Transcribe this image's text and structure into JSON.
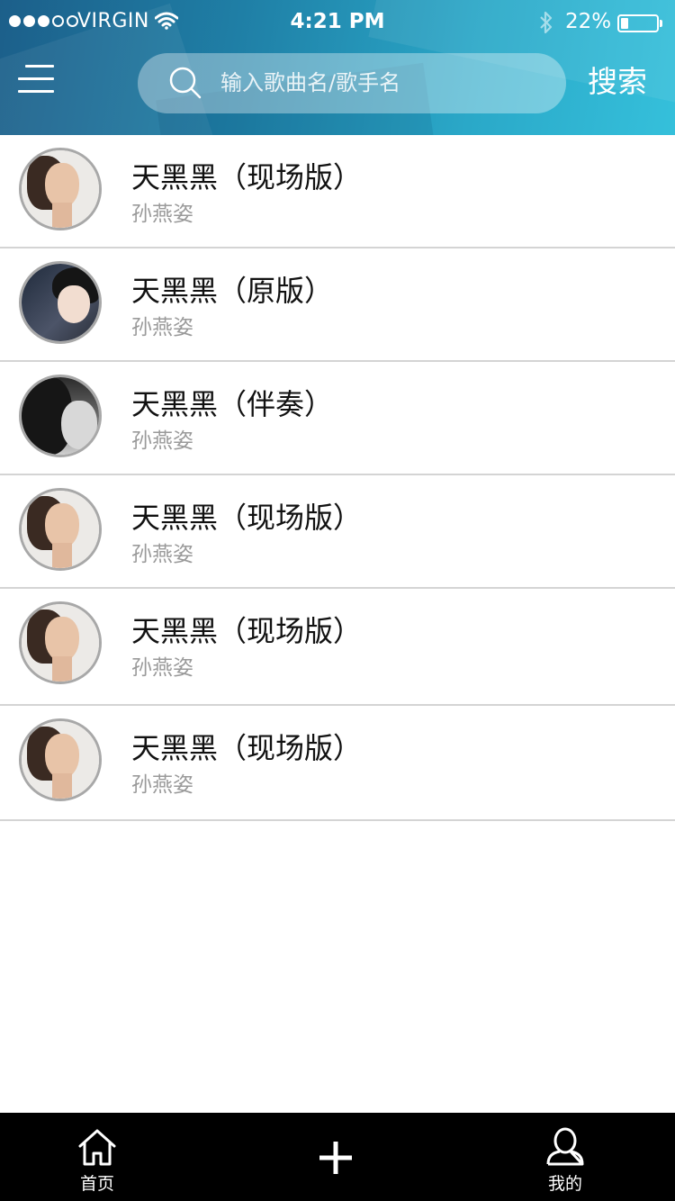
{
  "status_bar": {
    "carrier": "VIRGIN",
    "time": "4:21 PM",
    "battery_percent": "22%",
    "battery_level": 0.22,
    "signal_strength": 3,
    "signal_max": 5
  },
  "header": {
    "menu_icon": "hamburger-menu-icon",
    "search": {
      "placeholder": "输入歌曲名/歌手名",
      "value": ""
    },
    "search_button_label": "搜索"
  },
  "songs": [
    {
      "title": "天黑黑（现场版）",
      "artist": "孙燕姿"
    },
    {
      "title": "天黑黑（原版）",
      "artist": "孙燕姿"
    },
    {
      "title": "天黑黑（伴奏）",
      "artist": "孙燕姿"
    },
    {
      "title": "天黑黑（现场版）",
      "artist": "孙燕姿"
    },
    {
      "title": "天黑黑（现场版）",
      "artist": "孙燕姿"
    },
    {
      "title": "天黑黑（现场版）",
      "artist": "孙燕姿"
    }
  ],
  "tab_bar": {
    "home_label": "首页",
    "add_icon": "plus-icon",
    "me_label": "我的"
  },
  "colors": {
    "header_start": "#1c5f8a",
    "header_end": "#35c0db",
    "divider": "#d4d4d4",
    "artist_text": "#9a9a9a",
    "tab_bar": "#000000"
  }
}
